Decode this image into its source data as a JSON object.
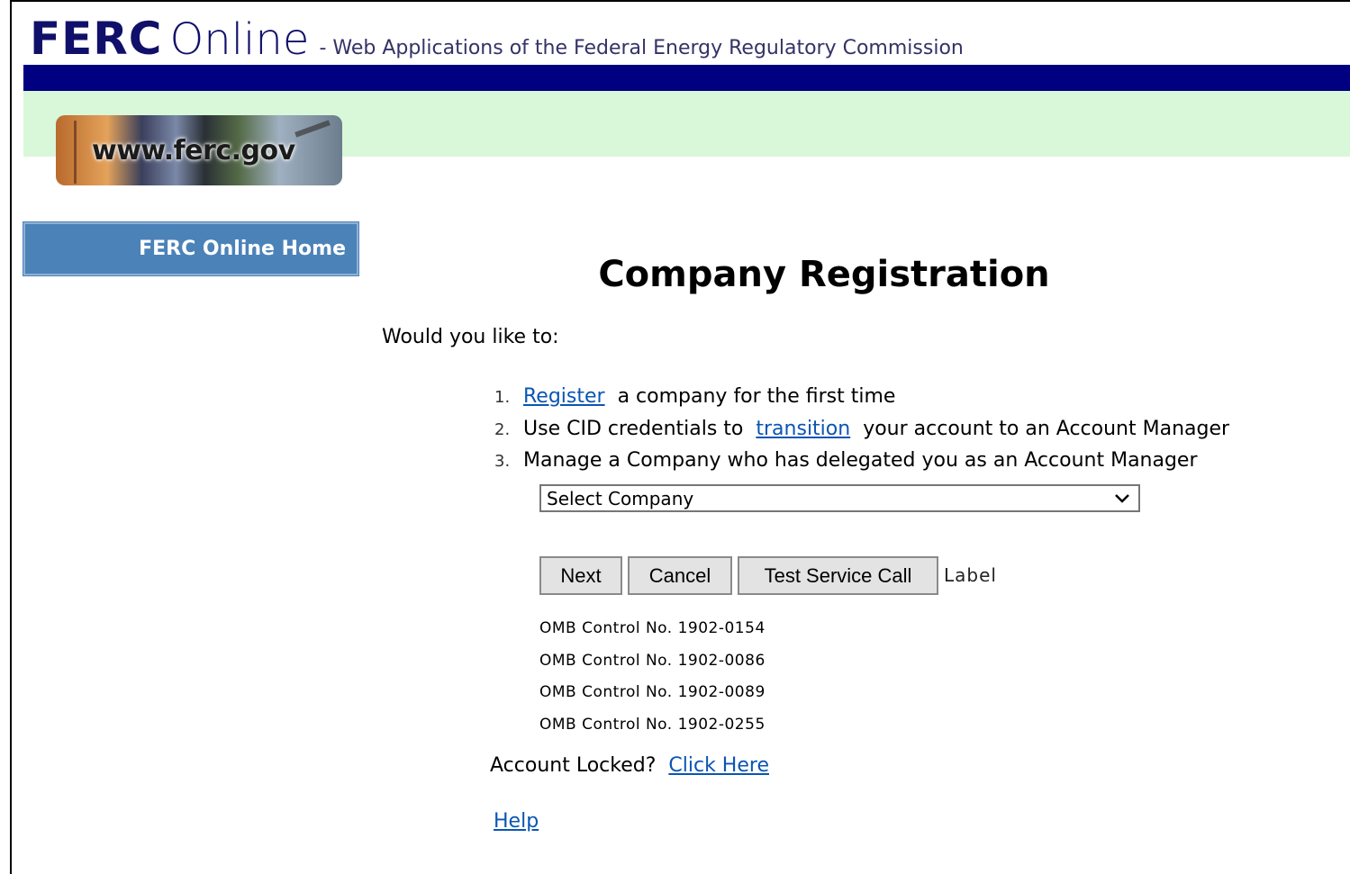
{
  "header": {
    "brand_ferc": "FERC",
    "brand_online": "Online",
    "tagline": "- Web Applications of the Federal Energy Regulatory Commission",
    "logo_text": "www.ferc.gov",
    "colors": {
      "navy": "#000080",
      "light_green": "#d9f7d9",
      "brand": "#10106a"
    }
  },
  "sidebar": {
    "home_label": "FERC Online Home",
    "home_color": "#4b82b8"
  },
  "main": {
    "title": "Company Registration",
    "prompt": "Would you like to:",
    "options": [
      {
        "num": "1.",
        "link": "Register",
        "after": "a company for the first time"
      },
      {
        "num": "2.",
        "before": "Use CID credentials to",
        "link": "transition",
        "after": "your account to an Account Manager"
      },
      {
        "num": "3.",
        "text": "Manage a Company who has delegated you as an Account Manager"
      }
    ],
    "company_select": {
      "selected": "Select Company",
      "icon": "chevron-down-icon"
    },
    "buttons": {
      "next": "Next",
      "cancel": "Cancel",
      "test": "Test Service Call"
    },
    "status_label": "Label",
    "omb": [
      "OMB Control No. 1902-0154",
      "OMB Control No. 1902-0086",
      "OMB Control No. 1902-0089",
      "OMB Control No. 1902-0255"
    ],
    "account_locked": {
      "text": "Account Locked?",
      "link": "Click Here"
    },
    "help_link": "Help",
    "link_color": "#0b55b3"
  }
}
